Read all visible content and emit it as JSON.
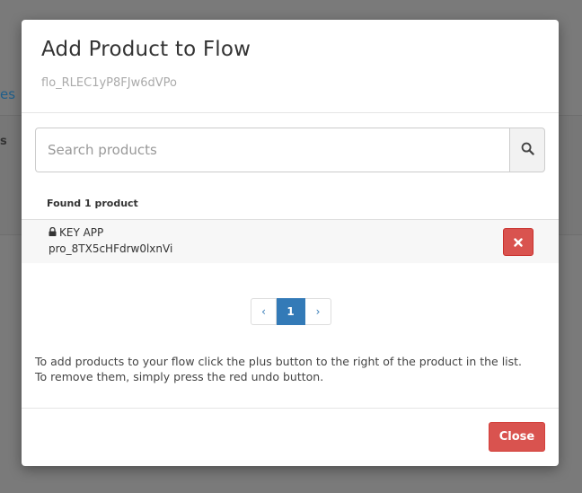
{
  "background": {
    "link_fragment": "es",
    "text_fragment": "s"
  },
  "modal": {
    "title": "Add Product to Flow",
    "flow_id": "flo_RLEC1yP8FJw6dVPo",
    "search": {
      "placeholder": "Search products",
      "value": "",
      "button_icon": "search-icon"
    },
    "results_count_text": "Found 1 product",
    "products": [
      {
        "lock_icon": "lock-icon",
        "name": "KEY APP",
        "id": "pro_8TX5cHFdrw0lxnVi",
        "action_icon": "times-icon"
      }
    ],
    "pagination": {
      "prev": "‹",
      "current": "1",
      "next": "›"
    },
    "help_line_1": "To add products to your flow click the plus button to the right of the product in the list.",
    "help_line_2": "To remove them, simply press the red undo button.",
    "close_label": "Close"
  },
  "colors": {
    "danger": "#d9534f",
    "primary": "#337ab7",
    "overlay": "#7b7b7b"
  }
}
